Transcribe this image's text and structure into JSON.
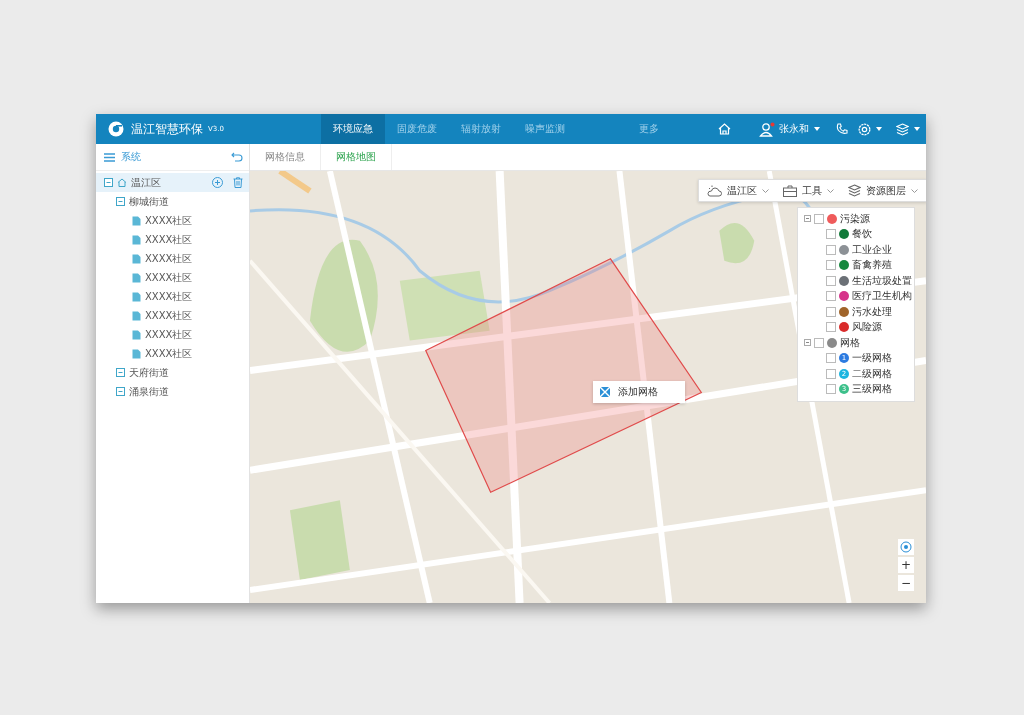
{
  "header": {
    "title": "温江智慧环保",
    "version": "V3.0",
    "nav": [
      {
        "label": "环境应急",
        "selected": true
      },
      {
        "label": "固废危废",
        "selected": false
      },
      {
        "label": "辐射放射",
        "selected": false
      },
      {
        "label": "噪声监测",
        "selected": false
      },
      {
        "label": "更多",
        "selected": false
      }
    ],
    "user": "张永和"
  },
  "sidebar": {
    "title": "系统",
    "tree": [
      {
        "label": "温江区",
        "selected": true,
        "children": [
          {
            "label": "柳城街道",
            "selected": false,
            "children": [
              {
                "label": "XXXX社区",
                "selected": false
              },
              {
                "label": "XXXX社区",
                "selected": false
              },
              {
                "label": "XXXX社区",
                "selected": false
              },
              {
                "label": "XXXX社区",
                "selected": false
              },
              {
                "label": "XXXX社区",
                "selected": false
              },
              {
                "label": "XXXX社区",
                "selected": false
              },
              {
                "label": "XXXX社区",
                "selected": false
              },
              {
                "label": "XXXX社区",
                "selected": false
              }
            ]
          },
          {
            "label": "天府街道",
            "selected": false
          },
          {
            "label": "涌泉街道",
            "selected": false
          }
        ]
      }
    ]
  },
  "tabs": [
    {
      "label": "网格信息",
      "selected": false
    },
    {
      "label": "网格地图",
      "selected": true
    }
  ],
  "map": {
    "kind": "picture",
    "toolbar": [
      {
        "kind": "weather",
        "label": "温江区"
      },
      {
        "kind": "tools",
        "label": "工具"
      },
      {
        "kind": "layers",
        "label": "资源图层"
      }
    ],
    "layer_groups": [
      {
        "label": "污染源",
        "color": "#ef5b5b",
        "checked": false,
        "items": [
          {
            "label": "餐饮",
            "color": "#127a3a",
            "checked": false
          },
          {
            "label": "工业企业",
            "color": "#8c9196",
            "checked": false
          },
          {
            "label": "畜禽养殖",
            "color": "#16883e",
            "checked": false
          },
          {
            "label": "生活垃圾处置",
            "color": "#6b7076",
            "checked": false
          },
          {
            "label": "医疗卫生机构",
            "color": "#d6338a",
            "checked": false
          },
          {
            "label": "污水处理",
            "color": "#a0642a",
            "checked": false
          },
          {
            "label": "风险源",
            "color": "#d92b2b",
            "checked": false
          }
        ]
      },
      {
        "label": "网格",
        "color": "#8a8a8a",
        "checked": false,
        "items": [
          {
            "label": "一级网格",
            "color": "#2d7be0",
            "checked": false,
            "badge": "1"
          },
          {
            "label": "二级网格",
            "color": "#1bb5e0",
            "checked": false,
            "badge": "2"
          },
          {
            "label": "三级网格",
            "color": "#3cc08a",
            "checked": false,
            "badge": "3"
          }
        ]
      }
    ],
    "popup": "添加网格",
    "zoom_in": "+",
    "zoom_out": "−"
  }
}
